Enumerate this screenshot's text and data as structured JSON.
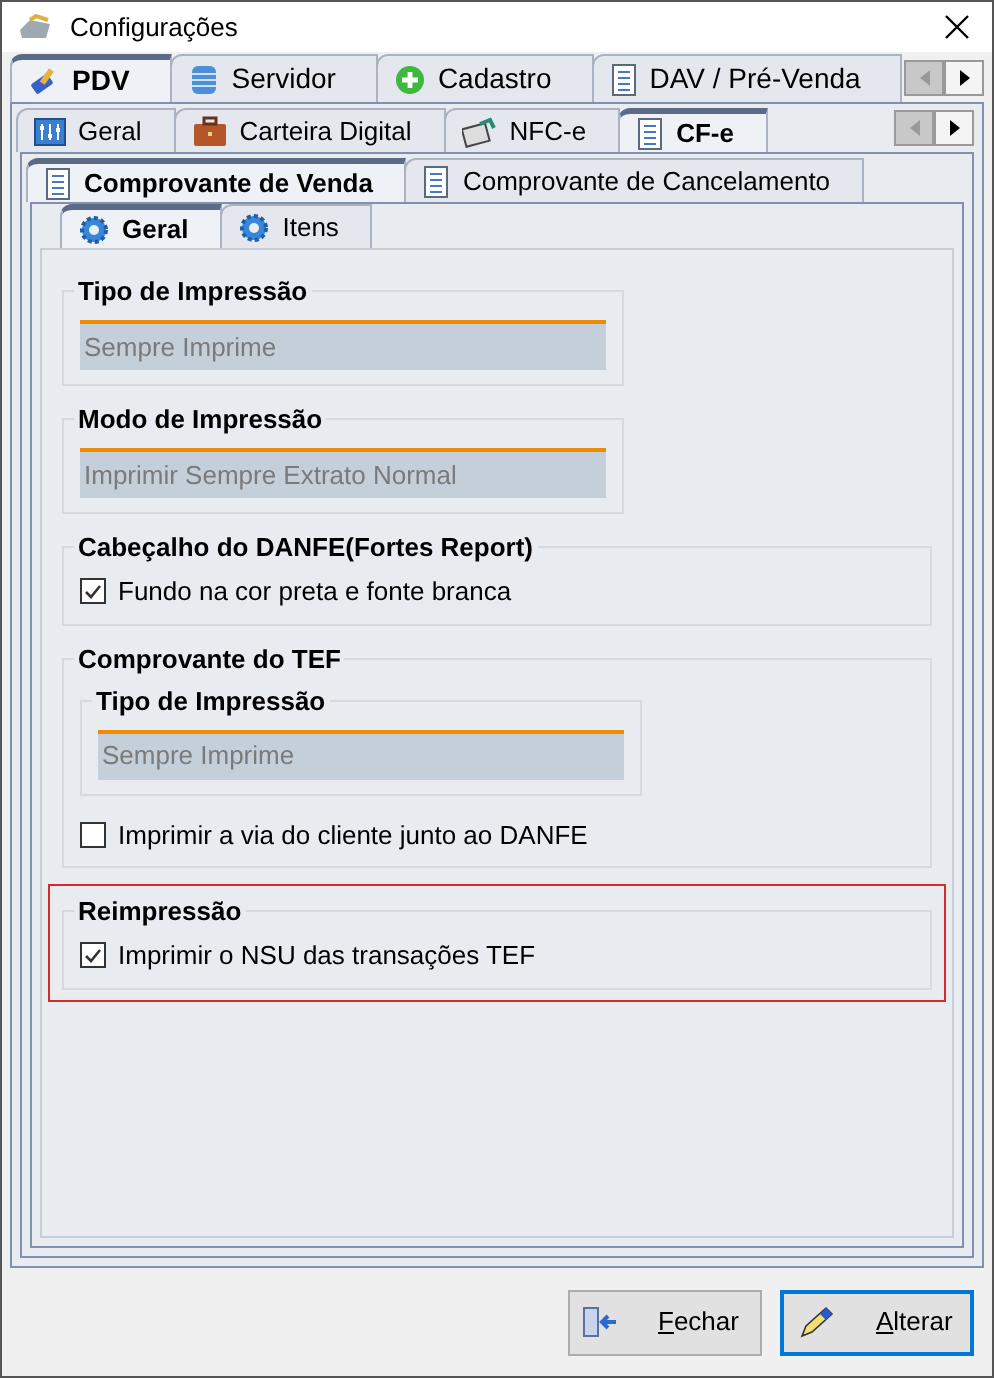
{
  "window": {
    "title": "Configurações"
  },
  "main_tabs": [
    {
      "label": "PDV",
      "selected": true
    },
    {
      "label": "Servidor",
      "selected": false
    },
    {
      "label": "Cadastro",
      "selected": false
    },
    {
      "label": "DAV / Pré-Venda",
      "selected": false
    }
  ],
  "sub_tabs": [
    {
      "label": "Geral",
      "selected": false
    },
    {
      "label": "Carteira Digital",
      "selected": false
    },
    {
      "label": "NFC-e",
      "selected": false
    },
    {
      "label": "CF-e",
      "selected": true
    }
  ],
  "receipt_tabs": [
    {
      "label": "Comprovante de Venda",
      "selected": true
    },
    {
      "label": "Comprovante de Cancelamento",
      "selected": false
    }
  ],
  "section_tabs": [
    {
      "label": "Geral",
      "selected": true
    },
    {
      "label": "Itens",
      "selected": false
    }
  ],
  "groups": [
    {
      "kind": "select",
      "title": "Tipo de Impressão",
      "value": "Sempre Imprime"
    },
    {
      "kind": "select",
      "title": "Modo de Impressão",
      "value": "Imprimir Sempre Extrato Normal"
    },
    {
      "kind": "checks",
      "title": "Cabeçalho do DANFE(Fortes Report)",
      "highlighted": false,
      "checks": [
        {
          "label": "Fundo na cor preta e fonte branca",
          "checked": true
        }
      ]
    },
    {
      "kind": "nested",
      "title": "Comprovante do TEF",
      "highlighted": false,
      "inner": {
        "title": "Tipo de Impressão",
        "value": "Sempre Imprime"
      },
      "checks": [
        {
          "label": "Imprimir a via do cliente junto ao DANFE",
          "checked": false
        }
      ]
    },
    {
      "kind": "checks",
      "title": "Reimpressão",
      "highlighted": true,
      "checks": [
        {
          "label": "Imprimir o NSU das transações TEF",
          "checked": true
        }
      ]
    }
  ],
  "buttons": [
    {
      "kind": "close",
      "mnemonic": "F",
      "rest": "echar",
      "focused": false
    },
    {
      "kind": "edit",
      "mnemonic": "A",
      "rest": "lterar",
      "focused": true
    }
  ]
}
